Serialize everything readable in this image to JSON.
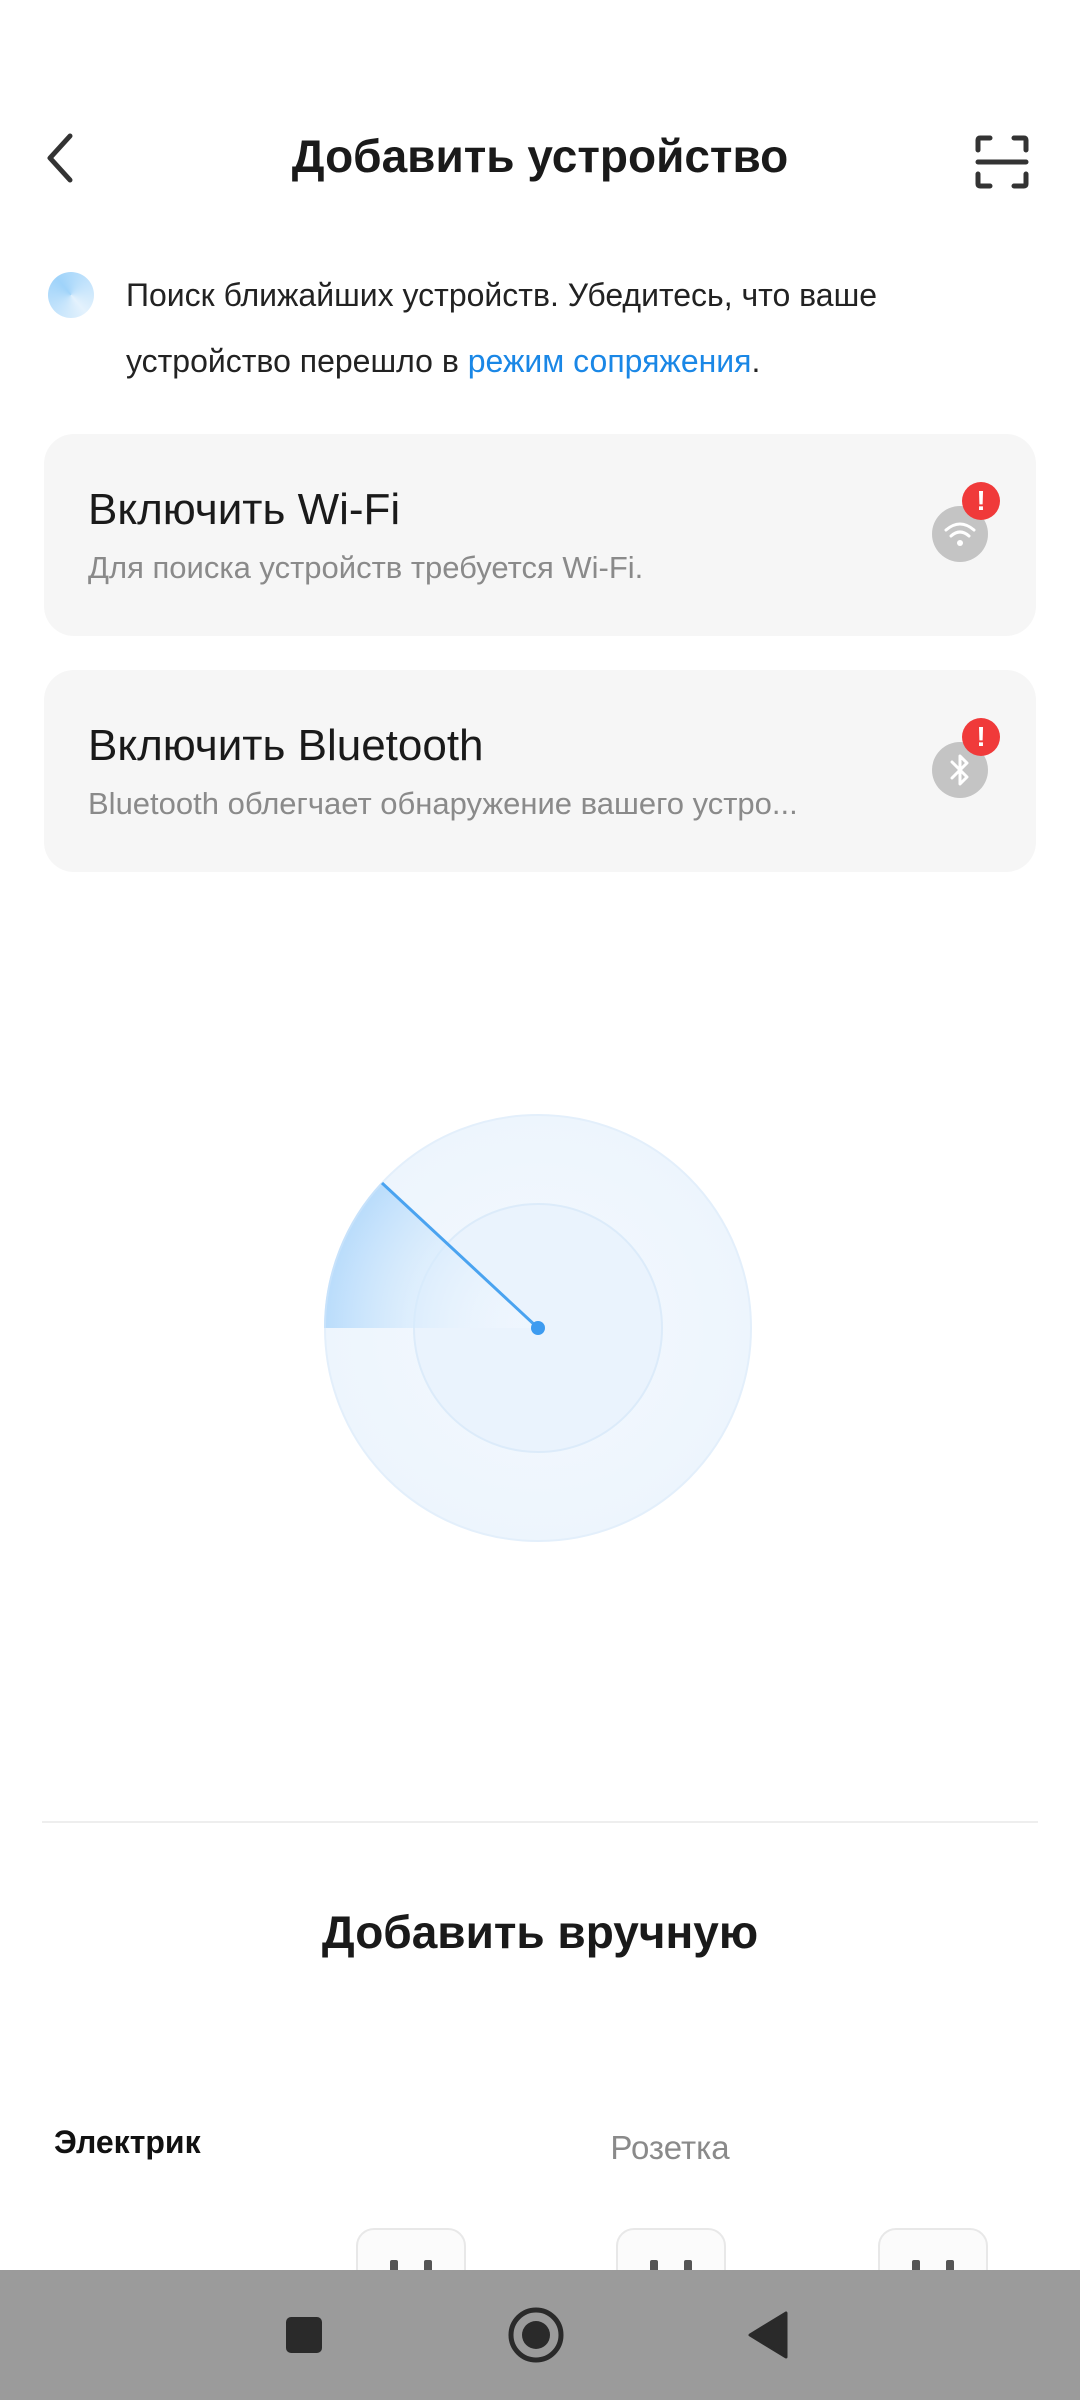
{
  "header": {
    "title": "Добавить устройство",
    "back_icon": "chevron-left-icon",
    "scan_icon": "scan-frame-icon"
  },
  "hint": {
    "text_before_link": "Поиск ближайших устройств. Убедитесь, что ваше устройство перешло в ",
    "link_text": "режим сопряжения",
    "text_after_link": ".",
    "link_color": "#1a87e6"
  },
  "cards": [
    {
      "title": "Включить Wi-Fi",
      "subtitle": "Для поиска устройств требуется Wi-Fi.",
      "icon": "wifi-icon",
      "badge": "!"
    },
    {
      "title": "Включить Bluetooth",
      "subtitle": "Bluetooth облегчает обнаружение вашего устро...",
      "icon": "bluetooth-icon",
      "badge": "!"
    }
  ],
  "radar": {
    "accent": "#4aa3f0"
  },
  "manual": {
    "title": "Добавить вручную",
    "category": "Электрик",
    "subcategory": "Розетка"
  },
  "navbar": {
    "items": [
      "recents-square-icon",
      "home-circle-icon",
      "back-triangle-icon"
    ],
    "background": "#9b9b9b"
  },
  "colors": {
    "badge": "#f03a3a",
    "card_bg": "#f6f6f6"
  }
}
